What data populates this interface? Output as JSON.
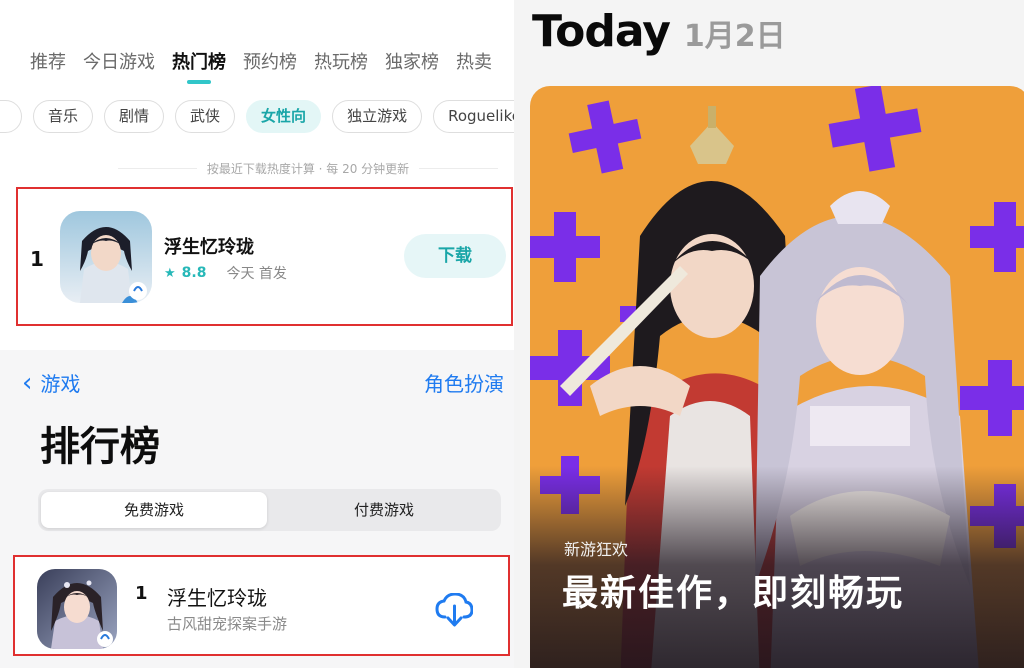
{
  "top_panel": {
    "tabs": [
      {
        "label": "推荐"
      },
      {
        "label": "今日游戏"
      },
      {
        "label": "热门榜"
      },
      {
        "label": "预约榜"
      },
      {
        "label": "热玩榜"
      },
      {
        "label": "独家榜"
      },
      {
        "label": "热卖"
      }
    ],
    "active_tab": "热门榜",
    "chips": [
      "",
      "音乐",
      "剧情",
      "武侠",
      "女性向",
      "独立游戏",
      "Roguelike"
    ],
    "active_chip": "女性向",
    "update_note": "按最近下载热度计算 · 每 20 分钟更新",
    "ranking_item": {
      "rank": "1",
      "name": "浮生忆玲珑",
      "rating": "8.8",
      "release": "今天 首发",
      "button": "下载"
    }
  },
  "bottom_panel": {
    "back_label": "游戏",
    "category": "角色扮演",
    "title": "排行榜",
    "segments": [
      "免费游戏",
      "付费游戏"
    ],
    "ranking_item": {
      "rank": "1",
      "name": "浮生忆玲珑",
      "subtitle": "古风甜宠探案手游"
    }
  },
  "today": {
    "title": "Today",
    "date": "1月2日",
    "card": {
      "tag": "新游狂欢",
      "headline": "最新佳作，即刻畅玩"
    }
  },
  "colors": {
    "accent_teal": "#31c6c9",
    "ios_blue": "#1f7bf0",
    "highlight_red": "#e03030",
    "card_orange": "#ef9f3a",
    "card_purple": "#7a2ee8"
  },
  "icons": [
    "chevron-left-icon",
    "star-icon",
    "cloud-download-icon"
  ]
}
